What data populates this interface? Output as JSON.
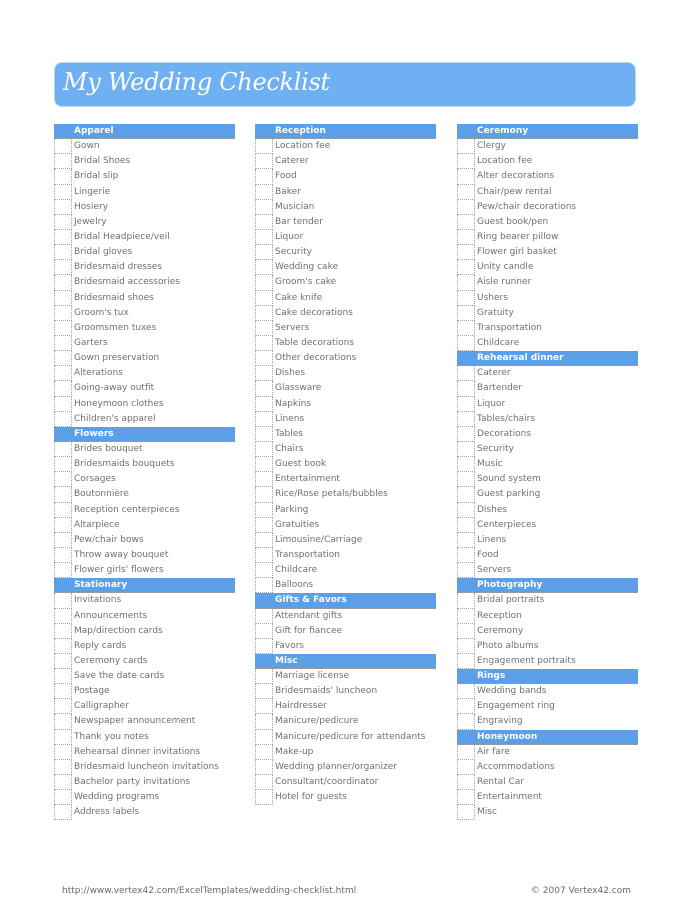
{
  "title": "My Wedding Checklist",
  "colors": {
    "banner": "#6eb0f2",
    "section_header": "#5b9fe8",
    "item_text": "#707070"
  },
  "columns": [
    {
      "sections": [
        {
          "title": "Apparel",
          "items": [
            "Gown",
            "Bridal Shoes",
            "Bridal slip",
            "Lingerie",
            "Hosiery",
            "Jewelry",
            "Bridal Headpiece/veil",
            "Bridal gloves",
            "Bridesmaid dresses",
            "Bridesmaid accessories",
            "Bridesmaid shoes",
            "Groom's tux",
            "Groomsmen tuxes",
            "Garters",
            "Gown preservation",
            "Alterations",
            "Going-away outfit",
            "Honeymoon clothes",
            "Children's apparel"
          ]
        },
        {
          "title": "Flowers",
          "items": [
            "Brides bouquet",
            "Bridesmaids bouquets",
            "Corsages",
            "Boutonnière",
            "Reception centerpieces",
            "Altarpiece",
            "Pew/chair bows",
            "Throw away bouquet",
            "Flower girls' flowers"
          ]
        },
        {
          "title": "Stationary",
          "items": [
            "Invitations",
            "Announcements",
            "Map/direction cards",
            "Reply cards",
            "Ceremony cards",
            "Save the date cards",
            "Postage",
            "Calligrapher",
            "Newspaper announcement",
            "Thank you notes",
            "Rehearsal dinner invitations",
            "Bridesmaid luncheon invitations",
            "Bachelor party invitations",
            "Wedding programs",
            "Address labels"
          ]
        }
      ]
    },
    {
      "sections": [
        {
          "title": "Reception",
          "items": [
            "Location fee",
            "Caterer",
            "Food",
            "Baker",
            "Musician",
            "Bar tender",
            "Liquor",
            "Security",
            "Wedding cake",
            "Groom's cake",
            "Cake knife",
            "Cake decorations",
            "Servers",
            "Table decorations",
            "Other decorations",
            "Dishes",
            "Glassware",
            "Napkins",
            "Linens",
            "Tables",
            "Chairs",
            "Guest book",
            "Entertainment",
            "Rice/Rose petals/bubbles",
            "Parking",
            "Gratuities",
            "Limousine/Carriage",
            "Transportation",
            "Childcare",
            "Balloons"
          ]
        },
        {
          "title": "Gifts & Favors",
          "items": [
            "Attendant gifts",
            "Gift for fiancee",
            "Favors"
          ]
        },
        {
          "title": "Misc",
          "items": [
            "Marriage license",
            "Bridesmaids' luncheon",
            "Hairdresser",
            "Manicure/pedicure",
            "Manicure/pedicure for attendants",
            "Make-up",
            "Wedding planner/organizer",
            "Consultant/coordinator",
            "Hotel for guests"
          ]
        }
      ]
    },
    {
      "sections": [
        {
          "title": "Ceremony",
          "items": [
            "Clergy",
            "Location fee",
            "Alter decorations",
            "Chair/pew rental",
            "Pew/chair decorations",
            "Guest book/pen",
            "Ring bearer pillow",
            "Flower girl basket",
            "Unity candle",
            "Aisle runner",
            "Ushers",
            "Gratuity",
            "Transportation",
            "Childcare"
          ]
        },
        {
          "title": "Rehearsal dinner",
          "items": [
            "Caterer",
            "Bartender",
            "Liquor",
            "Tables/chairs",
            "Decorations",
            "Security",
            "Music",
            "Sound system",
            "Guest parking",
            "Dishes",
            "Centerpieces",
            "Linens",
            "Food",
            "Servers"
          ]
        },
        {
          "title": "Photography",
          "items": [
            "Bridal portraits",
            "Reception",
            "Ceremony",
            "Photo albums",
            "Engagement portraits"
          ]
        },
        {
          "title": "Rings",
          "items": [
            "Wedding bands",
            "Engagement ring",
            "Engraving"
          ]
        },
        {
          "title": "Honeymoon",
          "items": [
            "Air fare",
            "Accommodations",
            "Rental Car",
            "Entertainment",
            "Misc"
          ]
        }
      ]
    }
  ],
  "footer": {
    "url": "http://www.vertex42.com/ExcelTemplates/wedding-checklist.html",
    "copyright": "© 2007 Vertex42.com"
  }
}
